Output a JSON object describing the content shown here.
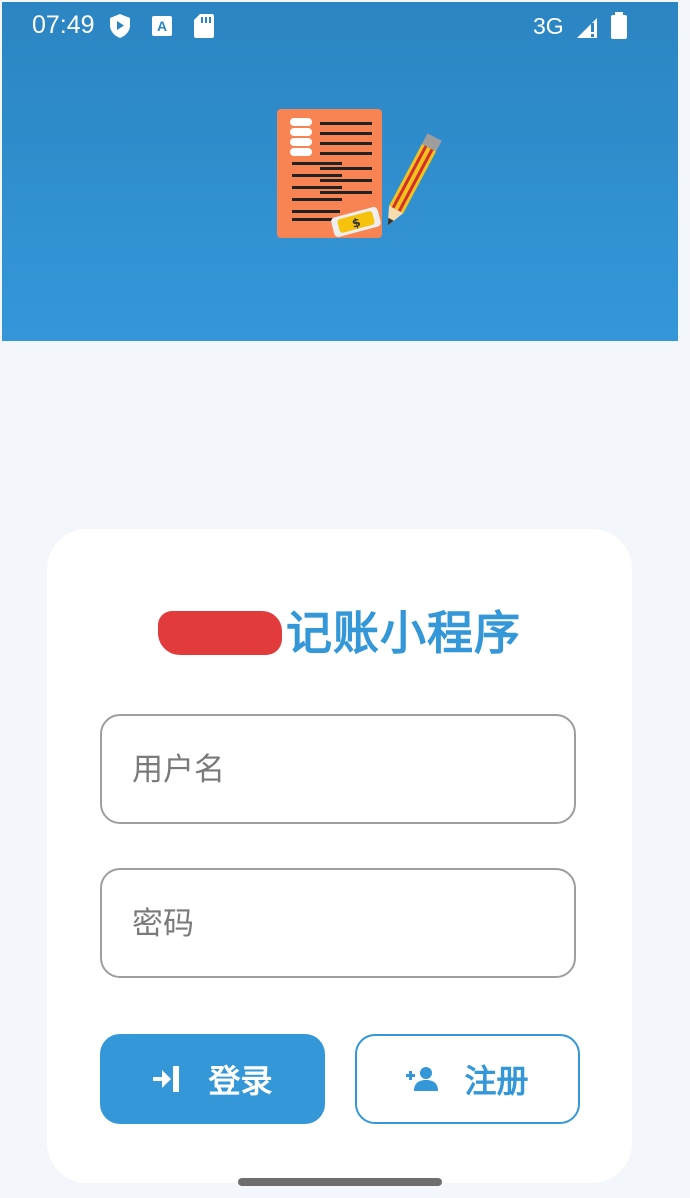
{
  "status_bar": {
    "time": "07:49",
    "network": "3G",
    "icons": [
      "shield-play-icon",
      "translate-icon",
      "sd-card-icon",
      "signal-icon",
      "battery-icon"
    ]
  },
  "header": {
    "logo": "ledger-pencil-logo",
    "background_colors": [
      "#2b85c2",
      "#3597d9"
    ]
  },
  "login_card": {
    "title": "记账小程序",
    "username": {
      "placeholder": "用户名",
      "value": ""
    },
    "password": {
      "placeholder": "密码",
      "value": ""
    },
    "login_button": {
      "label": "登录",
      "icon": "login-icon"
    },
    "register_button": {
      "label": "注册",
      "icon": "person-add-icon"
    }
  },
  "colors": {
    "accent": "#3397d8",
    "redaction": "#e23b3b",
    "page_background": "#f3f6fa"
  }
}
